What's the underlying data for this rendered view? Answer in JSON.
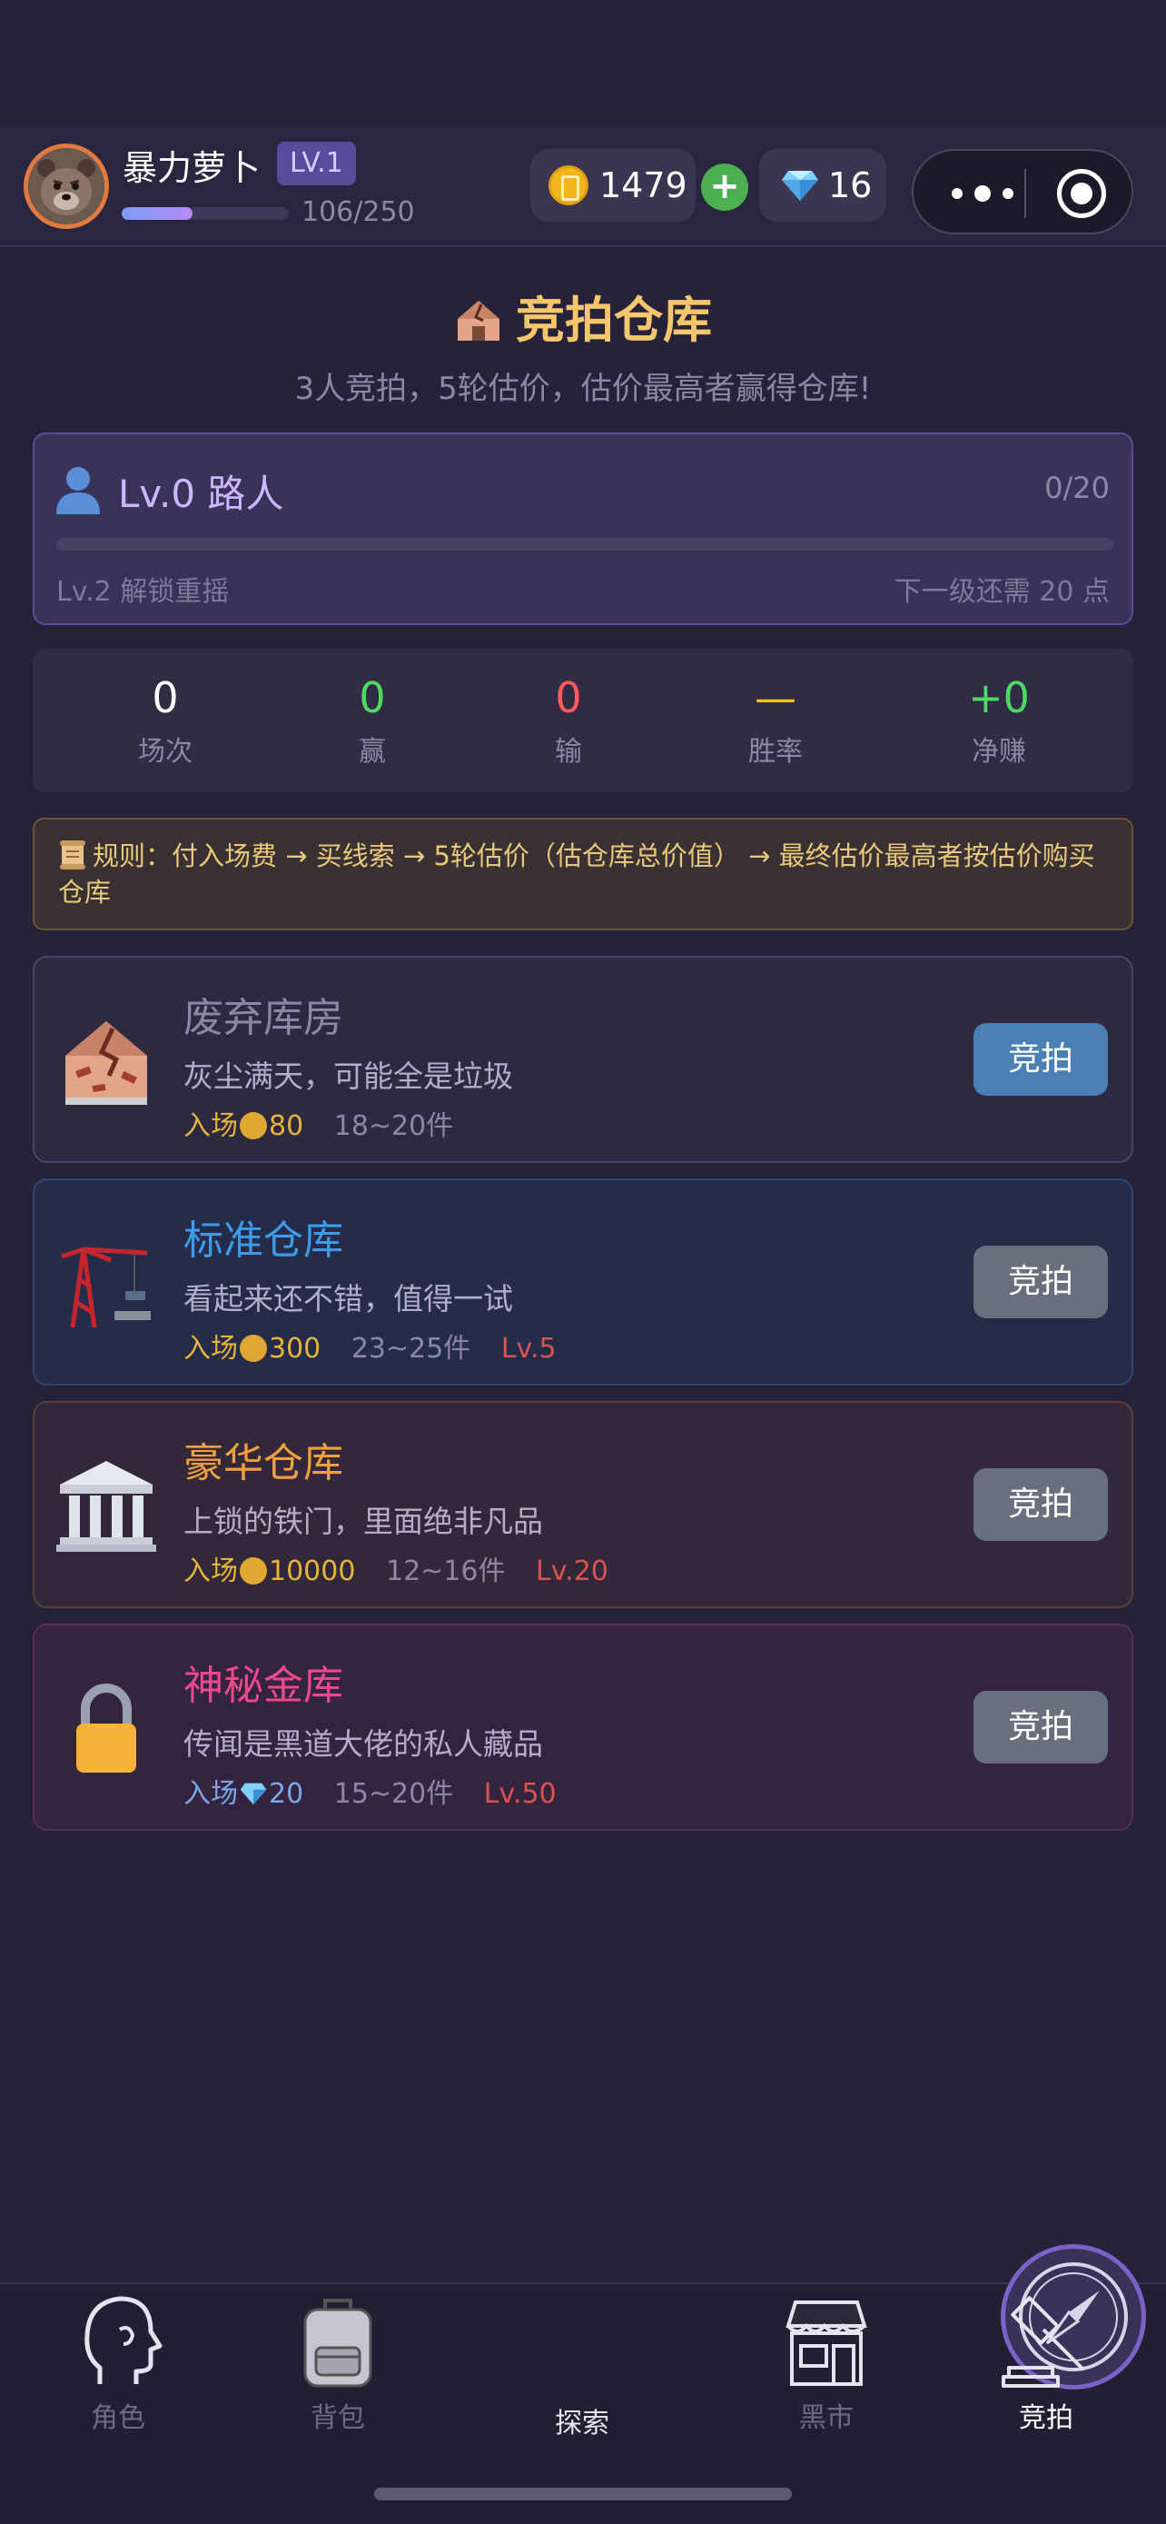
{
  "player": {
    "name": "暴力萝卜",
    "level_badge": "LV.1",
    "xp_text": "106/250",
    "xp_progress": 0.424
  },
  "currency": {
    "coins": "1479",
    "add_label": "+",
    "gems": "16"
  },
  "page": {
    "title": "竞拍仓库",
    "subtitle": "3人竞拍，5轮估价，估价最高者赢得仓库!"
  },
  "rank": {
    "title": "Lv.0 路人",
    "progress_text": "0/20",
    "progress": 0,
    "unlock_text": "Lv.2 解锁重摇",
    "next_text": "下一级还需 20 点"
  },
  "stats": [
    {
      "value": "0",
      "label": "场次",
      "color": "#ffffff"
    },
    {
      "value": "0",
      "label": "赢",
      "color": "#4cd964"
    },
    {
      "value": "0",
      "label": "输",
      "color": "#ff5a5f"
    },
    {
      "value": "—",
      "label": "胜率",
      "color": "#f5c518"
    },
    {
      "value": "+0",
      "label": "净赚",
      "color": "#4cd964"
    }
  ],
  "rule_text": "规则：付入场费 → 买线索 → 5轮估价（估仓库总价值） → 最终估价最高者按估价购买仓库",
  "warehouses": [
    {
      "name": "废弃库房",
      "desc": "灰尘满天，可能全是垃圾",
      "fee_label": "入场",
      "fee": "80",
      "count": "18~20件",
      "level": "",
      "button": "竞拍",
      "name_color": "#8c87a5",
      "bg": "#2d2940",
      "border": "#4a4560",
      "button_color": "#4a80b4",
      "icon": "abandoned-house-icon"
    },
    {
      "name": "标准仓库",
      "desc": "看起来还不错，值得一试",
      "fee_label": "入场",
      "fee": "300",
      "count": "23~25件",
      "level": "Lv.5",
      "button": "竞拍",
      "name_color": "#3d9be9",
      "bg": "#252c4a",
      "border": "#334670",
      "button_color": "#6a6f7e",
      "icon": "crane-icon"
    },
    {
      "name": "豪华仓库",
      "desc": "上锁的铁门，里面绝非凡品",
      "fee_label": "入场",
      "fee": "10000",
      "count": "12~16件",
      "level": "Lv.20",
      "button": "竞拍",
      "name_color": "#f0a040",
      "bg": "#33283a",
      "border": "#5a4038",
      "button_color": "#6a6f7e",
      "icon": "classical-building-icon"
    },
    {
      "name": "神秘金库",
      "desc": "传闻是黑道大佬的私人藏品",
      "fee_label": "入场",
      "fee": "20",
      "count": "15~20件",
      "level": "Lv.50",
      "button": "竞拍",
      "name_color": "#e84a8a",
      "bg": "#35243f",
      "border": "#5a3050",
      "button_color": "#6a6f7e",
      "icon": "lock-icon"
    }
  ],
  "nav": [
    {
      "label": "角色",
      "icon": "head-profile-icon",
      "active": false
    },
    {
      "label": "背包",
      "icon": "backpack-icon",
      "active": false
    },
    {
      "label": "探索",
      "icon": "compass-icon",
      "active": false
    },
    {
      "label": "黑市",
      "icon": "shop-icon",
      "active": false
    },
    {
      "label": "竞拍",
      "icon": "gavel-icon",
      "active": true
    }
  ]
}
